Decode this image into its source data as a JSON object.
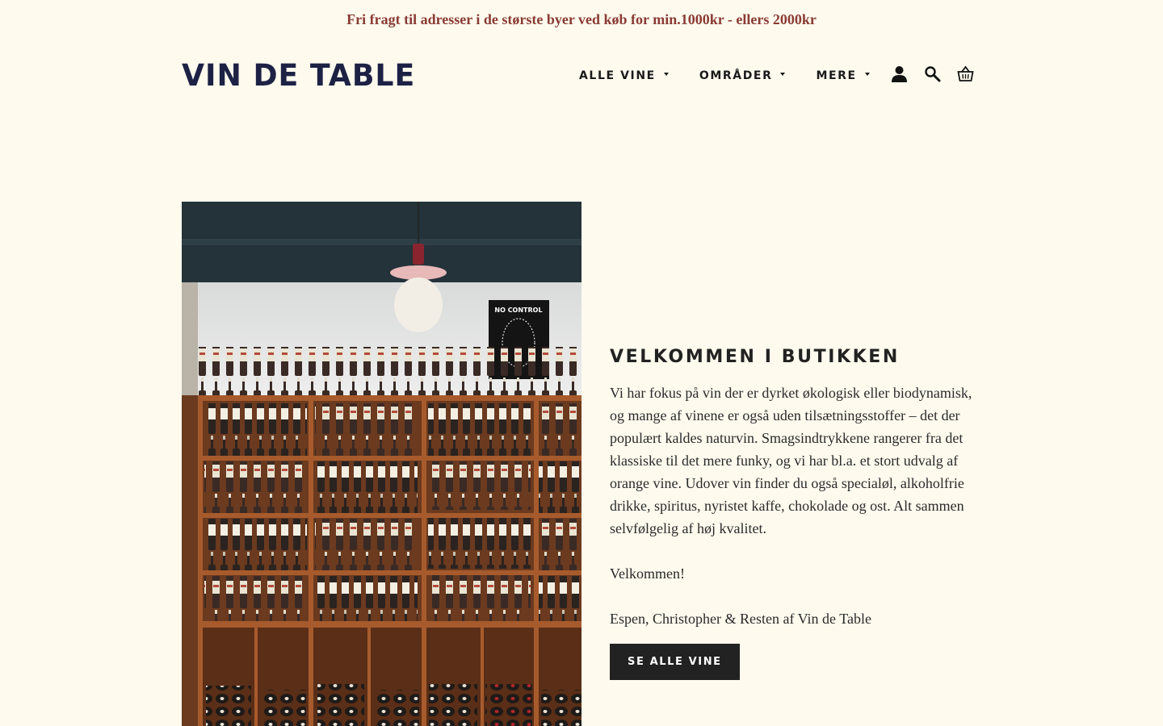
{
  "announcement": "Fri fragt til adresser i de største byer ved køb for min.1000kr - ellers 2000kr",
  "header": {
    "logo": "VIN DE TABLE",
    "nav": [
      {
        "label": "ALLE VINE"
      },
      {
        "label": "OMRÅDER"
      },
      {
        "label": "MERE"
      }
    ],
    "icons": [
      "account-icon",
      "search-icon",
      "cart-icon"
    ]
  },
  "hero": {
    "image_icon": "wine-shelf-photo",
    "poster_text": "NO CONTROL"
  },
  "welcome": {
    "heading": "VELKOMMEN I BUTIKKEN",
    "body": "Vi har fokus på vin der er dyrket økologisk eller biodynamisk, og mange af vinene er også uden tilsætningsstoffer – det der populært kaldes naturvin. Smagsindtrykkene rangerer fra det klassiske til det mere funky, og vi har bl.a. et stort udvalg af orange vine. Udover vin finder du også specialøl, alkoholfrie drikke, spiritus, nyristet kaffe, chokolade og ost. Alt sammen selvfølgelig af høj kvalitet.",
    "greeting": "Velkommen!",
    "signature": "Espen, Christopher & Resten af Vin de Table",
    "button": "SE ALLE VINE"
  },
  "colors": {
    "background": "#fefaee",
    "announcement": "#8a3b35",
    "logo": "#1d2245",
    "button": "#222222"
  }
}
